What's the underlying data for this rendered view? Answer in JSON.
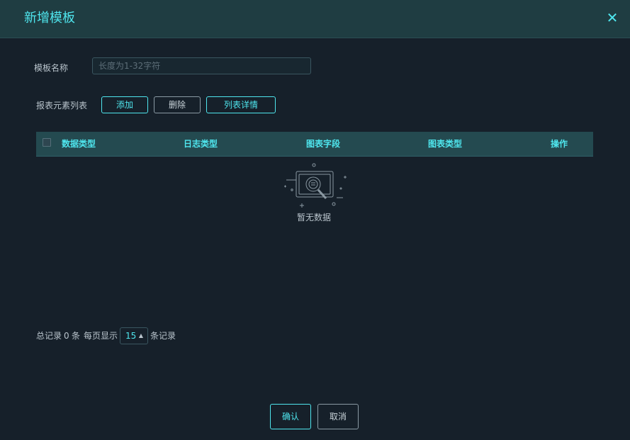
{
  "dialog": {
    "title": "新增模板"
  },
  "form": {
    "name_label": "模板名称",
    "name_placeholder": "长度为1-32字符",
    "name_value": ""
  },
  "elements": {
    "label": "报表元素列表",
    "add_label": "添加",
    "delete_label": "删除",
    "detail_label": "列表详情"
  },
  "table": {
    "columns": [
      "数据类型",
      "日志类型",
      "图表字段",
      "图表类型",
      "操作"
    ],
    "rows": [],
    "empty_text": "暂无数据"
  },
  "pager": {
    "total_prefix": "总记录",
    "total": "0",
    "total_suffix": "条",
    "per_page_label": "每页显示",
    "per_page": "15",
    "per_page_suffix": "条记录"
  },
  "footer": {
    "confirm_label": "确认",
    "cancel_label": "取消"
  },
  "colors": {
    "accent": "#4fe6ee",
    "background": "#16202a",
    "header": "#1f3d42",
    "table_header": "#244a50"
  },
  "icons": {
    "close": "close-icon",
    "empty": "empty-data-icon",
    "dropdown": "caret-up-icon"
  }
}
